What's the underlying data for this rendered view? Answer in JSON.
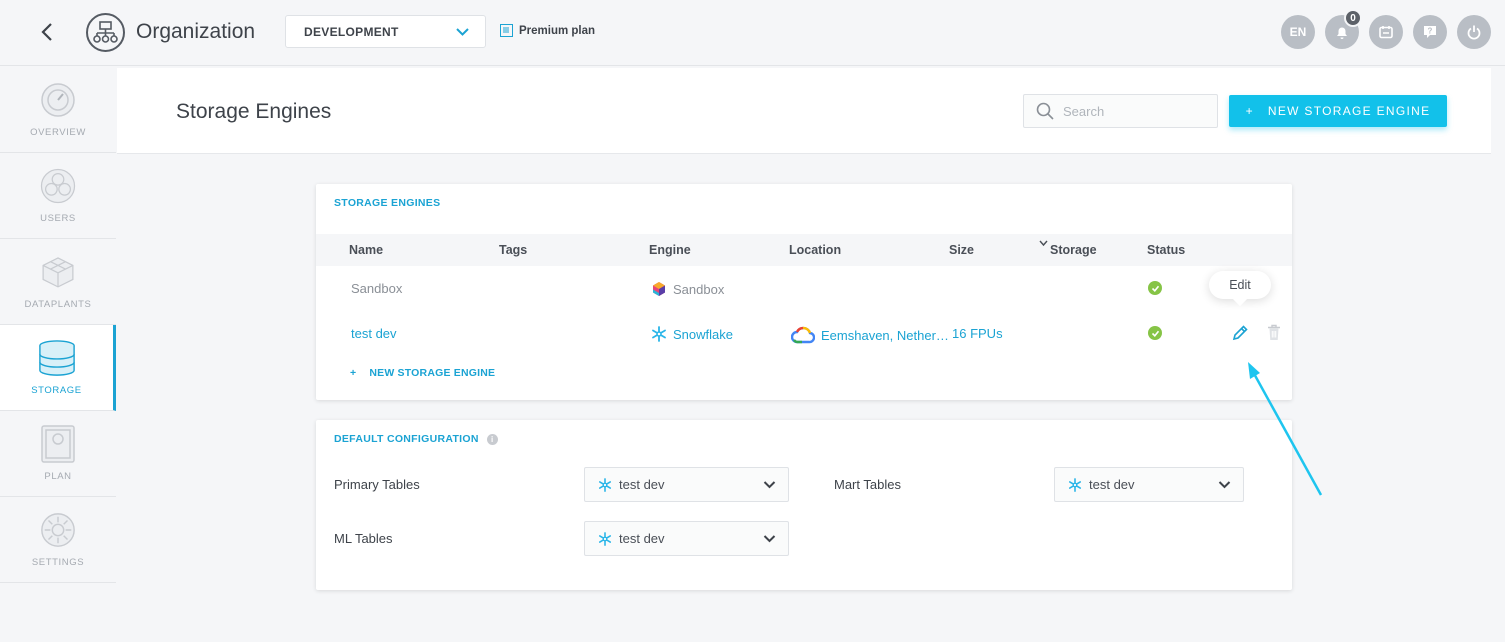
{
  "topbar": {
    "org_title": "Organization",
    "environment": "DEVELOPMENT",
    "plan_label": "Premium plan",
    "lang": "EN",
    "notifications_count": "0"
  },
  "sidebar": {
    "items": [
      {
        "label": "OVERVIEW"
      },
      {
        "label": "USERS"
      },
      {
        "label": "DATAPLANTS"
      },
      {
        "label": "STORAGE"
      },
      {
        "label": "PLAN"
      },
      {
        "label": "SETTINGS"
      }
    ]
  },
  "header": {
    "title": "Storage Engines",
    "search_placeholder": "Search",
    "new_button": "NEW STORAGE ENGINE",
    "new_button_plus": "+"
  },
  "storage_card": {
    "title": "STORAGE ENGINES",
    "columns": [
      "Name",
      "Tags",
      "Engine",
      "Location",
      "Size",
      "Storage",
      "Status"
    ],
    "rows": [
      {
        "name": "Sandbox",
        "engine": "Sandbox",
        "location": "",
        "size": ""
      },
      {
        "name": "test dev",
        "engine": "Snowflake",
        "location": "Eemshaven, Nether…",
        "size": "16 FPUs"
      }
    ],
    "add_label": "NEW STORAGE ENGINE",
    "add_plus": "+",
    "tooltip": "Edit"
  },
  "default_config": {
    "title": "DEFAULT CONFIGURATION",
    "primary_label": "Primary Tables",
    "primary_value": "test dev",
    "mart_label": "Mart Tables",
    "mart_value": "test dev",
    "ml_label": "ML Tables",
    "ml_value": "test dev"
  },
  "colors": {
    "accent": "#1ba3d3",
    "button": "#12c1ea",
    "status_ok": "#86c446"
  }
}
